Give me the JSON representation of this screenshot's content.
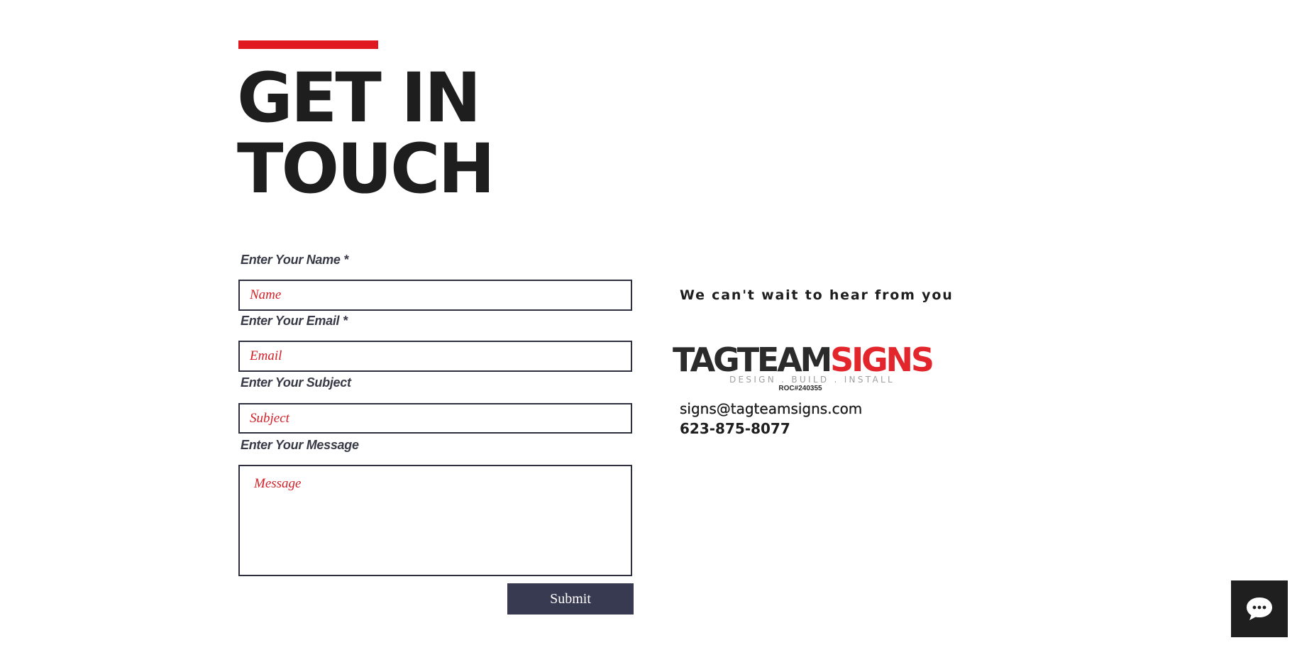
{
  "heading": {
    "line1": "GET IN",
    "line2": "TOUCH"
  },
  "form": {
    "name": {
      "label": "Enter Your Name *",
      "placeholder": "Name",
      "value": ""
    },
    "email": {
      "label": "Enter Your Email *",
      "placeholder": "Email",
      "value": ""
    },
    "subject": {
      "label": "Enter Your Subject",
      "placeholder": "Subject",
      "value": ""
    },
    "message": {
      "label": "Enter Your Message",
      "placeholder": "Message",
      "value": ""
    },
    "submit_label": "Submit"
  },
  "contact": {
    "tagline": "We can't wait to hear from you",
    "logo": {
      "word_dark": "TAGTEAM",
      "word_red": "SIGNS",
      "subtitle": "DESIGN . BUILD . INSTALL",
      "license": "ROC#240355"
    },
    "email": "signs@tagteamsigns.com",
    "phone": "623-875-8077"
  },
  "chat": {
    "icon": "chat-bubble-icon"
  },
  "colors": {
    "accent_red": "#e0191f",
    "heading_text": "#1e1e1e",
    "input_border": "#2e3040",
    "placeholder_red": "#d42027",
    "button_bg": "#383a51",
    "chat_bg": "#1f1f1f"
  }
}
